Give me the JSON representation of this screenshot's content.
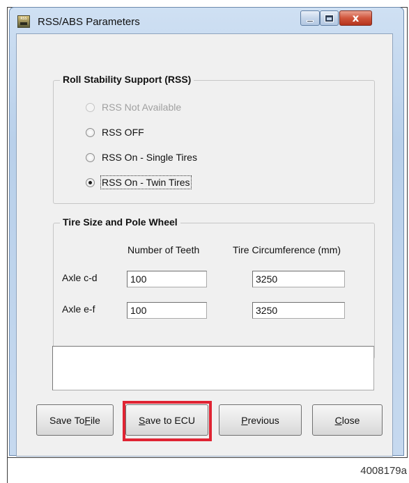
{
  "window": {
    "title": "RSS/ABS Parameters",
    "icon_text": "RSS",
    "close_glyph": "x"
  },
  "rss": {
    "legend": "Roll Stability Support (RSS)",
    "options": [
      {
        "label": "RSS Not Available",
        "enabled": false,
        "selected": false
      },
      {
        "label": "RSS OFF",
        "enabled": true,
        "selected": false
      },
      {
        "label": "RSS On - Single Tires",
        "enabled": true,
        "selected": false
      },
      {
        "label": "RSS On - Twin Tires",
        "enabled": true,
        "selected": true
      }
    ]
  },
  "tire": {
    "legend": "Tire Size and Pole Wheel",
    "col_teeth": "Number of Teeth",
    "col_circ": "Tire Circumference (mm)",
    "rows": [
      {
        "label": "Axle c-d",
        "teeth": "100",
        "circumference": "3250"
      },
      {
        "label": "Axle e-f",
        "teeth": "100",
        "circumference": "3250"
      }
    ]
  },
  "message": "",
  "buttons": {
    "save_file": {
      "pre": "Save To ",
      "key": "F",
      "post": "ile"
    },
    "save_ecu": {
      "pre": "",
      "key": "S",
      "post": "ave to ECU"
    },
    "previous": {
      "pre": "",
      "key": "P",
      "post": "revious"
    },
    "close": {
      "pre": "",
      "key": "C",
      "post": "lose"
    }
  },
  "highlight_color": "#e02433",
  "figure_id": "4008179a"
}
